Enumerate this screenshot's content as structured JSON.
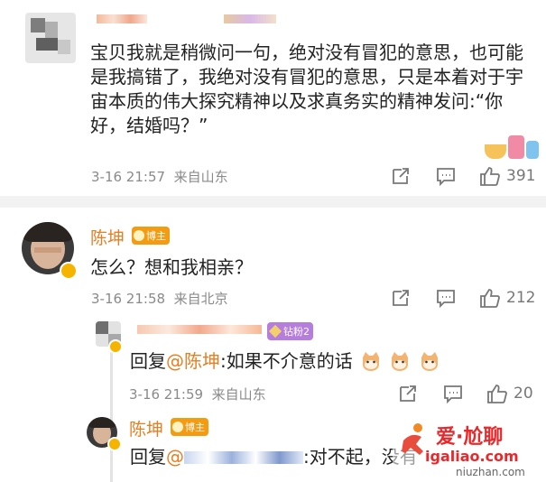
{
  "comment1": {
    "text": "宝贝我就是稍微问一句，绝对没有冒犯的意思，也可能是我搞错了，我绝对没有冒犯的意思，只是本着对于宇宙本质的伟大探究精神以及求真务实的精神发问:“你好，结婚吗？”",
    "time": "3-16 21:57",
    "source": "来自山东",
    "likes": "391"
  },
  "comment2": {
    "author": "陈坤",
    "badge": "博主",
    "text": "怎么？想和我相亲？",
    "time": "3-16 21:58",
    "source": "来自北京",
    "likes": "212"
  },
  "reply1": {
    "badge": "钻粉2",
    "prefix": "回复",
    "mention": "@陈坤",
    "text": ":如果不介意的话",
    "time": "3-16 21:59",
    "source": "来自山东",
    "likes": "20"
  },
  "reply2": {
    "author": "陈坤",
    "badge": "博主",
    "prefix": "回复",
    "mention": "@",
    "text": ":对不起，没有"
  },
  "watermark": {
    "line1": "爱·尬聊",
    "line2": "igaliao.com",
    "line3": "niuzhan.com"
  },
  "colors": {
    "accent": "#e67e22",
    "badge_orange": "#f39c12",
    "badge_purple": "#b57edc"
  }
}
